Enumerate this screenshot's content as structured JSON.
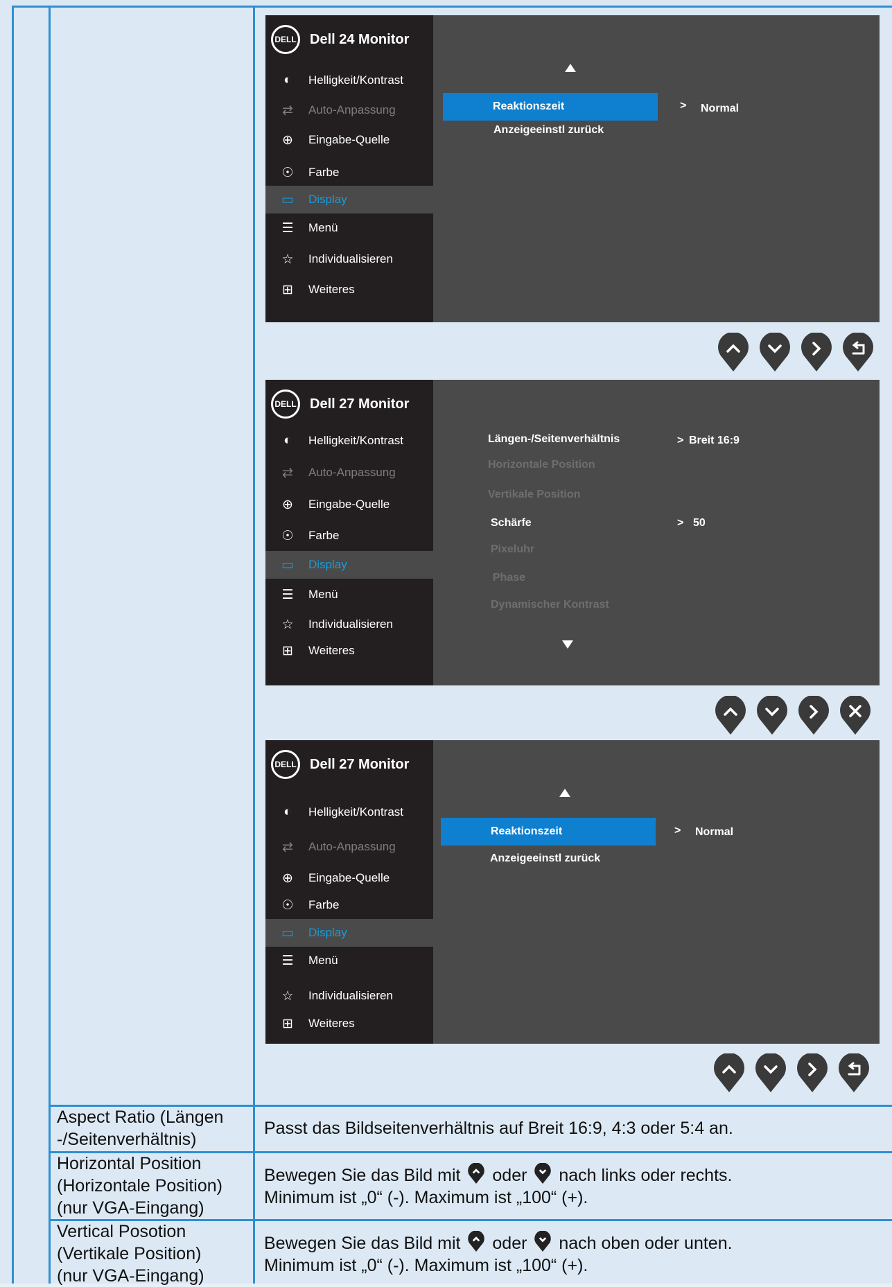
{
  "osd1": {
    "title": "Dell 24 Monitor",
    "menu": [
      "Helligkeit/Kontrast",
      "Auto-Anpassung",
      "Eingabe-Quelle",
      "Farbe",
      "Display",
      "Menü",
      "Individualisieren",
      "Weiteres"
    ],
    "highlight": "Reaktionszeit",
    "highlight_value": "Normal",
    "item2": "Anzeigeeinstl zurück"
  },
  "osd2": {
    "title": "Dell 27 Monitor",
    "menu": [
      "Helligkeit/Kontrast",
      "Auto-Anpassung",
      "Eingabe-Quelle",
      "Farbe",
      "Display",
      "Menü",
      "Individualisieren",
      "Weiteres"
    ],
    "items": [
      "Längen-/Seitenverhältnis",
      "Horizontale Position",
      "Vertikale Position",
      "Schärfe",
      "Pixeluhr",
      "Phase",
      "Dynamischer Kontrast"
    ],
    "val_ratio": "Breit 16:9",
    "val_sharp": "50"
  },
  "osd3": {
    "title": "Dell 27 Monitor",
    "menu": [
      "Helligkeit/Kontrast",
      "Auto-Anpassung",
      "Eingabe-Quelle",
      "Farbe",
      "Display",
      "Menü",
      "Individualisieren",
      "Weiteres"
    ],
    "highlight": "Reaktionszeit",
    "highlight_value": "Normal",
    "item2": "Anzeigeeinstl zurück"
  },
  "chevron": ">",
  "logo": "DELL",
  "table": {
    "r1_left": "Aspect Ratio (Längen -/Seitenverhältnis)",
    "r1_l1": "Aspect Ratio (Längen",
    "r1_l2": "-/Seitenverhältnis)",
    "r1_right": "Passt das Bildseitenverhältnis auf Breit 16:9, 4:3 oder 5:4 an.",
    "r2_l1": "Horizontal Position",
    "r2_l2": "(Horizontale Position)",
    "r2_l3": "(nur VGA-Eingang)",
    "r2_a": "Bewegen Sie das Bild mit",
    "r2_b": "oder",
    "r2_c": "nach links oder rechts.",
    "r2_d": "Minimum ist „0“ (-). Maximum ist „100“ (+).",
    "r3_l1": "Vertical Posotion",
    "r3_l2": "(Vertikale Position)",
    "r3_l3": "(nur VGA-Eingang)",
    "r3_a": "Bewegen Sie das Bild mit",
    "r3_b": "oder",
    "r3_c": "nach oben oder unten.",
    "r3_d": "Minimum ist „0“ (-). Maximum ist „100“ (+)."
  }
}
